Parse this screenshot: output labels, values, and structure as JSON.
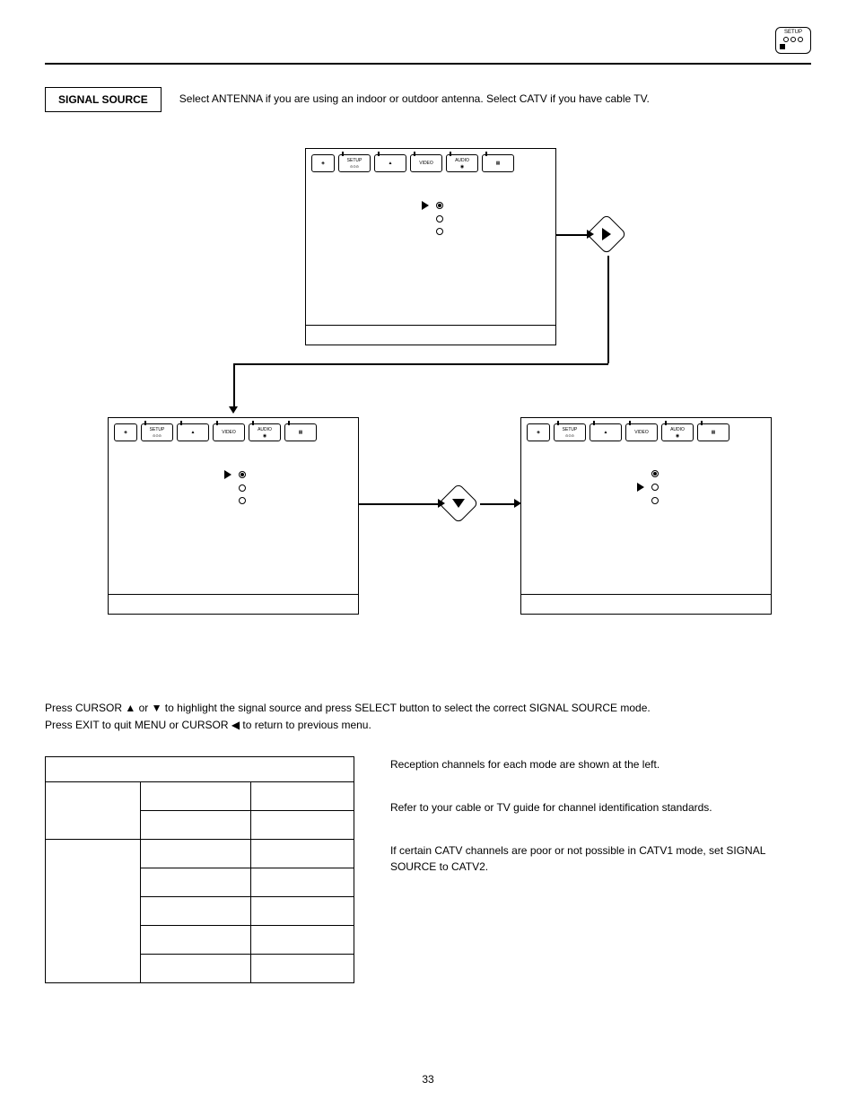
{
  "badge": {
    "label": "SETUP"
  },
  "section": {
    "title": "SIGNAL SOURCE",
    "intro": "Select ANTENNA if you are using an indoor or outdoor antenna.  Select CATV if you have cable TV."
  },
  "tabs": {
    "t1": "SETUP",
    "t2": "",
    "t3": "VIDEO",
    "t4": "AUDIO",
    "t5": ""
  },
  "instructions": {
    "line1_a": "Press CURSOR ",
    "line1_b": " or ",
    "line1_c": " to highlight the signal source and press SELECT button to select the correct SIGNAL SOURCE mode.",
    "line2_a": "Press EXIT to quit MENU or CURSOR ",
    "line2_b": " to return to previous menu."
  },
  "notes": {
    "p1": "Reception channels for each mode are shown at the left.",
    "p2": "Refer to your cable or TV guide for channel identification standards.",
    "p3": "If certain CATV channels are poor or not possible in CATV1 mode, set SIGNAL SOURCE to CATV2."
  },
  "page_number": "33"
}
